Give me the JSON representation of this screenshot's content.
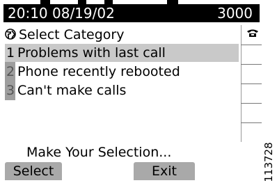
{
  "status_bar": {
    "datetime": "20:10 08/19/02",
    "extension": "3000"
  },
  "header": {
    "icon": "globe-icon",
    "title": "Select Category"
  },
  "line_buttons": {
    "icon": "phone-icon"
  },
  "menu": {
    "items": [
      {
        "number": "1",
        "label": "Problems with last call",
        "selected": true
      },
      {
        "number": "2",
        "label": "Phone recently rebooted",
        "selected": false
      },
      {
        "number": "3",
        "label": "Can't make calls",
        "selected": false
      }
    ]
  },
  "prompt": "Make Your Selection...",
  "softkeys": {
    "select": "Select",
    "exit": "Exit"
  },
  "figure_id": "113728",
  "colors": {
    "status_bar_bg": "#000000",
    "selected_row": "#c9c9c9",
    "softkey_bg": "#a9a9a9"
  }
}
